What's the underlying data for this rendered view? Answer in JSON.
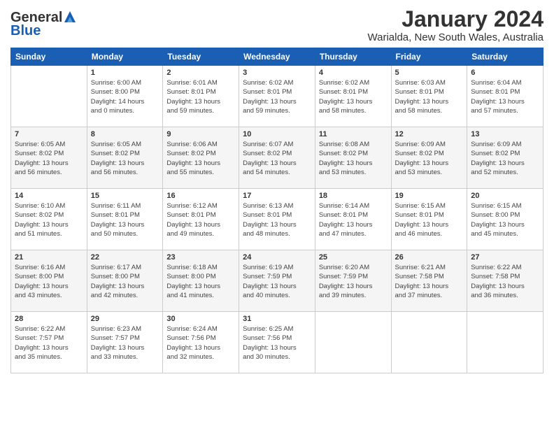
{
  "header": {
    "logo_general": "General",
    "logo_blue": "Blue",
    "month": "January 2024",
    "location": "Warialda, New South Wales, Australia"
  },
  "days_of_week": [
    "Sunday",
    "Monday",
    "Tuesday",
    "Wednesday",
    "Thursday",
    "Friday",
    "Saturday"
  ],
  "weeks": [
    [
      {
        "day": "",
        "sunrise": "",
        "sunset": "",
        "daylight": ""
      },
      {
        "day": "1",
        "sunrise": "Sunrise: 6:00 AM",
        "sunset": "Sunset: 8:00 PM",
        "daylight": "Daylight: 14 hours and 0 minutes."
      },
      {
        "day": "2",
        "sunrise": "Sunrise: 6:01 AM",
        "sunset": "Sunset: 8:01 PM",
        "daylight": "Daylight: 13 hours and 59 minutes."
      },
      {
        "day": "3",
        "sunrise": "Sunrise: 6:02 AM",
        "sunset": "Sunset: 8:01 PM",
        "daylight": "Daylight: 13 hours and 59 minutes."
      },
      {
        "day": "4",
        "sunrise": "Sunrise: 6:02 AM",
        "sunset": "Sunset: 8:01 PM",
        "daylight": "Daylight: 13 hours and 58 minutes."
      },
      {
        "day": "5",
        "sunrise": "Sunrise: 6:03 AM",
        "sunset": "Sunset: 8:01 PM",
        "daylight": "Daylight: 13 hours and 58 minutes."
      },
      {
        "day": "6",
        "sunrise": "Sunrise: 6:04 AM",
        "sunset": "Sunset: 8:01 PM",
        "daylight": "Daylight: 13 hours and 57 minutes."
      }
    ],
    [
      {
        "day": "7",
        "sunrise": "Sunrise: 6:05 AM",
        "sunset": "Sunset: 8:02 PM",
        "daylight": "Daylight: 13 hours and 56 minutes."
      },
      {
        "day": "8",
        "sunrise": "Sunrise: 6:05 AM",
        "sunset": "Sunset: 8:02 PM",
        "daylight": "Daylight: 13 hours and 56 minutes."
      },
      {
        "day": "9",
        "sunrise": "Sunrise: 6:06 AM",
        "sunset": "Sunset: 8:02 PM",
        "daylight": "Daylight: 13 hours and 55 minutes."
      },
      {
        "day": "10",
        "sunrise": "Sunrise: 6:07 AM",
        "sunset": "Sunset: 8:02 PM",
        "daylight": "Daylight: 13 hours and 54 minutes."
      },
      {
        "day": "11",
        "sunrise": "Sunrise: 6:08 AM",
        "sunset": "Sunset: 8:02 PM",
        "daylight": "Daylight: 13 hours and 53 minutes."
      },
      {
        "day": "12",
        "sunrise": "Sunrise: 6:09 AM",
        "sunset": "Sunset: 8:02 PM",
        "daylight": "Daylight: 13 hours and 53 minutes."
      },
      {
        "day": "13",
        "sunrise": "Sunrise: 6:09 AM",
        "sunset": "Sunset: 8:02 PM",
        "daylight": "Daylight: 13 hours and 52 minutes."
      }
    ],
    [
      {
        "day": "14",
        "sunrise": "Sunrise: 6:10 AM",
        "sunset": "Sunset: 8:02 PM",
        "daylight": "Daylight: 13 hours and 51 minutes."
      },
      {
        "day": "15",
        "sunrise": "Sunrise: 6:11 AM",
        "sunset": "Sunset: 8:01 PM",
        "daylight": "Daylight: 13 hours and 50 minutes."
      },
      {
        "day": "16",
        "sunrise": "Sunrise: 6:12 AM",
        "sunset": "Sunset: 8:01 PM",
        "daylight": "Daylight: 13 hours and 49 minutes."
      },
      {
        "day": "17",
        "sunrise": "Sunrise: 6:13 AM",
        "sunset": "Sunset: 8:01 PM",
        "daylight": "Daylight: 13 hours and 48 minutes."
      },
      {
        "day": "18",
        "sunrise": "Sunrise: 6:14 AM",
        "sunset": "Sunset: 8:01 PM",
        "daylight": "Daylight: 13 hours and 47 minutes."
      },
      {
        "day": "19",
        "sunrise": "Sunrise: 6:15 AM",
        "sunset": "Sunset: 8:01 PM",
        "daylight": "Daylight: 13 hours and 46 minutes."
      },
      {
        "day": "20",
        "sunrise": "Sunrise: 6:15 AM",
        "sunset": "Sunset: 8:00 PM",
        "daylight": "Daylight: 13 hours and 45 minutes."
      }
    ],
    [
      {
        "day": "21",
        "sunrise": "Sunrise: 6:16 AM",
        "sunset": "Sunset: 8:00 PM",
        "daylight": "Daylight: 13 hours and 43 minutes."
      },
      {
        "day": "22",
        "sunrise": "Sunrise: 6:17 AM",
        "sunset": "Sunset: 8:00 PM",
        "daylight": "Daylight: 13 hours and 42 minutes."
      },
      {
        "day": "23",
        "sunrise": "Sunrise: 6:18 AM",
        "sunset": "Sunset: 8:00 PM",
        "daylight": "Daylight: 13 hours and 41 minutes."
      },
      {
        "day": "24",
        "sunrise": "Sunrise: 6:19 AM",
        "sunset": "Sunset: 7:59 PM",
        "daylight": "Daylight: 13 hours and 40 minutes."
      },
      {
        "day": "25",
        "sunrise": "Sunrise: 6:20 AM",
        "sunset": "Sunset: 7:59 PM",
        "daylight": "Daylight: 13 hours and 39 minutes."
      },
      {
        "day": "26",
        "sunrise": "Sunrise: 6:21 AM",
        "sunset": "Sunset: 7:58 PM",
        "daylight": "Daylight: 13 hours and 37 minutes."
      },
      {
        "day": "27",
        "sunrise": "Sunrise: 6:22 AM",
        "sunset": "Sunset: 7:58 PM",
        "daylight": "Daylight: 13 hours and 36 minutes."
      }
    ],
    [
      {
        "day": "28",
        "sunrise": "Sunrise: 6:22 AM",
        "sunset": "Sunset: 7:57 PM",
        "daylight": "Daylight: 13 hours and 35 minutes."
      },
      {
        "day": "29",
        "sunrise": "Sunrise: 6:23 AM",
        "sunset": "Sunset: 7:57 PM",
        "daylight": "Daylight: 13 hours and 33 minutes."
      },
      {
        "day": "30",
        "sunrise": "Sunrise: 6:24 AM",
        "sunset": "Sunset: 7:56 PM",
        "daylight": "Daylight: 13 hours and 32 minutes."
      },
      {
        "day": "31",
        "sunrise": "Sunrise: 6:25 AM",
        "sunset": "Sunset: 7:56 PM",
        "daylight": "Daylight: 13 hours and 30 minutes."
      },
      {
        "day": "",
        "sunrise": "",
        "sunset": "",
        "daylight": ""
      },
      {
        "day": "",
        "sunrise": "",
        "sunset": "",
        "daylight": ""
      },
      {
        "day": "",
        "sunrise": "",
        "sunset": "",
        "daylight": ""
      }
    ]
  ]
}
